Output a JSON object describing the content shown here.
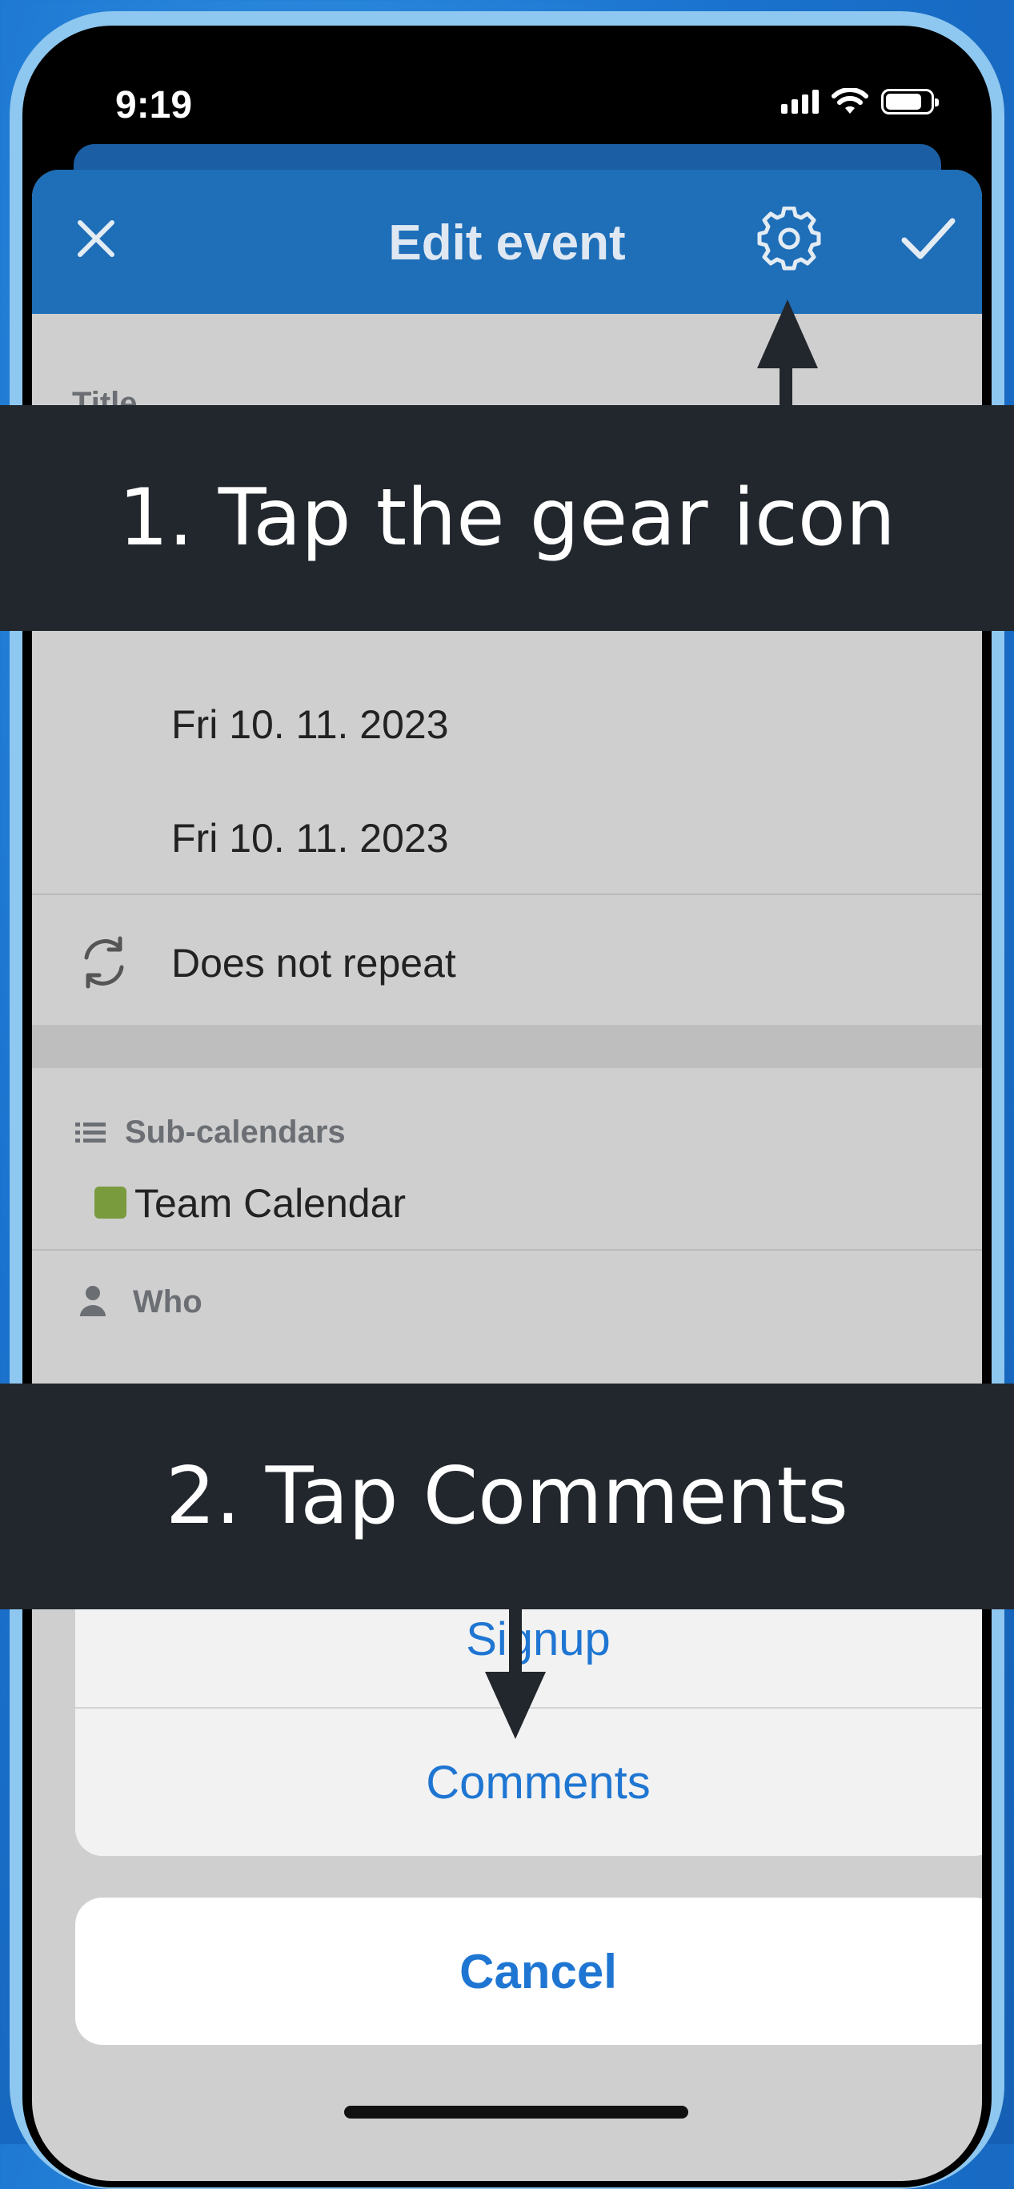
{
  "status_bar": {
    "time": "9:19"
  },
  "header": {
    "title": "Edit event",
    "close_icon": "close-icon",
    "gear_icon": "gear-icon",
    "check_icon": "check-icon"
  },
  "form": {
    "title_label": "Title",
    "start_date": "Fri 10. 11. 2023",
    "end_date": "Fri 10. 11. 2023",
    "repeat_label": "Does not repeat",
    "subcalendars_label": "Sub-calendars",
    "subcalendar_name": "Team Calendar",
    "subcalendar_color": "#7a9a3e",
    "who_label": "Who"
  },
  "action_sheet": {
    "items": [
      "Signup",
      "Comments"
    ],
    "cancel_label": "Cancel"
  },
  "annotations": {
    "step1": "1.  Tap the gear icon",
    "step2": "2. Tap Comments"
  },
  "colors": {
    "header_blue": "#1e6eb8",
    "action_blue": "#1f76d2",
    "banner_dark": "#22272d"
  }
}
